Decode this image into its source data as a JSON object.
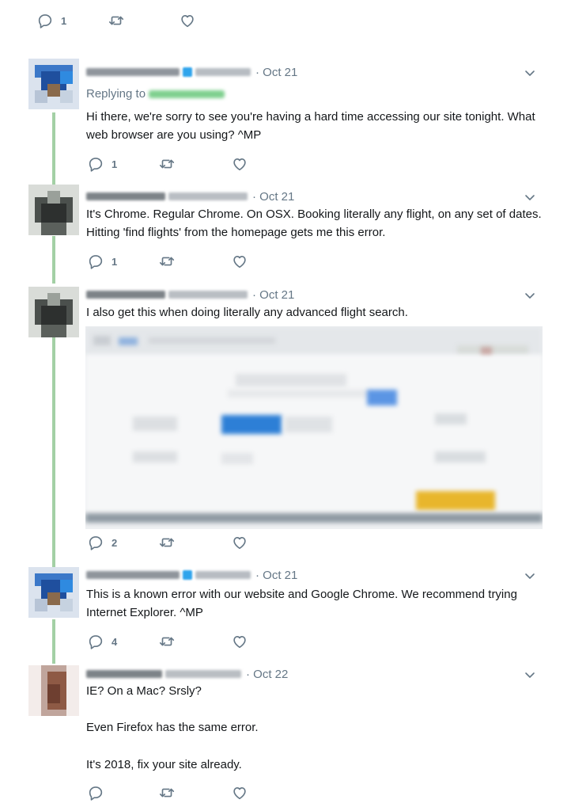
{
  "top_actions": {
    "reply_count": "1"
  },
  "colors": {
    "thread_line": "#a3d0a5",
    "meta_gray": "#657786",
    "text": "#14171a",
    "bar_gold": "#e8b62c",
    "button_blue": "#2d7fd6"
  },
  "icons": {
    "reply": "reply-icon",
    "retweet": "retweet-icon",
    "like": "heart-icon",
    "menu": "chevron-down-icon"
  },
  "tweets": [
    {
      "date": "· Oct 21",
      "replying_to": "Replying to",
      "text": "Hi there, we're sorry to see you're having a hard time accessing our site tonight. What web browser are you using? ^MP",
      "reply_count": "1"
    },
    {
      "date": "· Oct 21",
      "text": "It's Chrome. Regular Chrome. On OSX. Booking literally any flight, on any set of dates. Hitting 'find flights' from the homepage gets me this error.",
      "reply_count": "1"
    },
    {
      "date": "· Oct 21",
      "text": "I also get this when doing literally any advanced flight search.",
      "reply_count": "2"
    },
    {
      "date": "· Oct 21",
      "text": "This is a known error with our website and Google Chrome. We recommend trying Internet Explorer. ^MP",
      "reply_count": "4"
    },
    {
      "date": "· Oct 22",
      "text_lines": [
        "IE? On a Mac? Srsly?",
        "Even Firefox has the same error.",
        "It's 2018, fix your site already."
      ],
      "reply_count": ""
    }
  ]
}
